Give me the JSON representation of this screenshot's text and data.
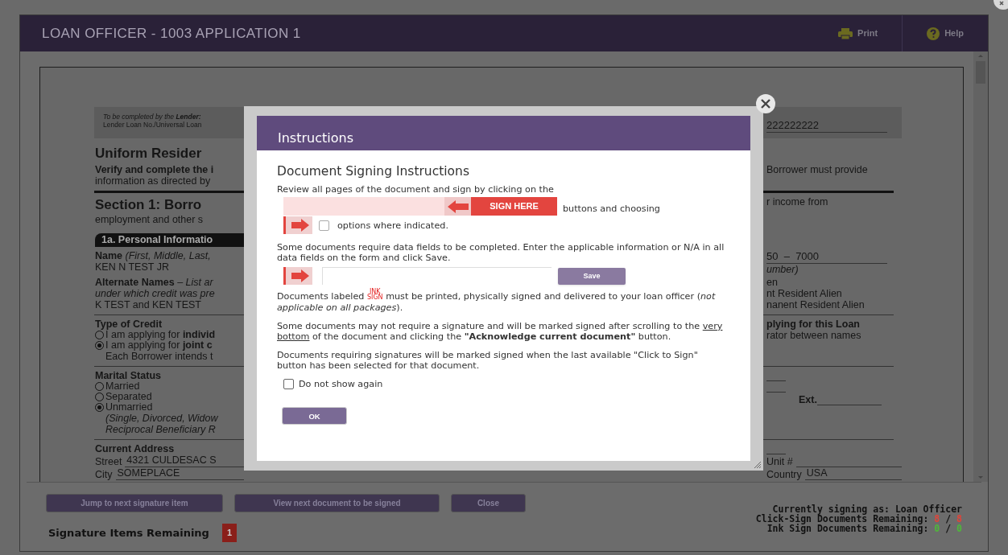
{
  "window": {
    "title": "LOAN OFFICER - 1003 APPLICATION 1",
    "actions": [
      {
        "kind": "print",
        "label": "Print"
      },
      {
        "kind": "help",
        "label": "Help"
      }
    ]
  },
  "document": {
    "rows": [
      {
        "kind": "box",
        "left": [
          {
            "kind": "italic",
            "text": "To be completed by the **Lender:**"
          },
          {
            "kind": "small",
            "text": "Lender Loan No./Universal Loan"
          }
        ],
        "right": [
          {
            "kind": "value",
            "text": "222222222"
          }
        ]
      },
      {
        "kind": "row",
        "left": [
          {
            "kind": "big",
            "text": "Uniform Resider"
          }
        ],
        "right": []
      },
      {
        "kind": "row",
        "left": [
          {
            "kind": "bold",
            "text": "Verify and complete the i"
          },
          {
            "kind": "plain",
            "text": "information as directed by"
          }
        ],
        "right": [
          {
            "kind": "plain",
            "text": "Borrower must provide"
          }
        ],
        "rule": true,
        "thick": true
      },
      {
        "kind": "row",
        "left": [
          {
            "kind": "big",
            "text": "Section 1: Borro"
          },
          {
            "kind": "plain",
            "text": "employment and other s"
          }
        ],
        "right": [
          {
            "kind": "plain",
            "text": "r income from"
          }
        ]
      },
      {
        "kind": "row",
        "left": [
          {
            "kind": "pill",
            "text": "1a. Personal Informatio"
          }
        ],
        "right": []
      },
      {
        "kind": "row",
        "left": [
          {
            "kind": "plain",
            "text": "**Name** *(First, Middle, Last,*"
          },
          {
            "kind": "plain",
            "text": "KEN N TEST JR"
          }
        ],
        "right": [
          {
            "kind": "value",
            "text": "50  –  7000"
          },
          {
            "kind": "italic",
            "text": "umber)"
          }
        ]
      },
      {
        "kind": "row",
        "left": [
          {
            "kind": "plain",
            "text": "**Alternate Names** – *List ar*"
          },
          {
            "kind": "italic",
            "text": "under which credit was pre"
          },
          {
            "kind": "plain",
            "text": "K  TEST and KEN  TEST"
          }
        ],
        "right": [
          {
            "kind": "plain",
            "text": "en"
          },
          {
            "kind": "plain",
            "text": "nt Resident Alien"
          },
          {
            "kind": "plain",
            "text": "nanent Resident Alien"
          }
        ],
        "rule": true
      },
      {
        "kind": "row",
        "left": [
          {
            "kind": "bold",
            "text": "Type of Credit"
          },
          {
            "kind": "radio",
            "text": "I am applying for **individ**",
            "selected": false
          },
          {
            "kind": "radio",
            "text": "I am applying for **joint c**",
            "selected": true
          },
          {
            "kind": "indent",
            "text": "Each Borrower intends t"
          }
        ],
        "right": [
          {
            "kind": "bold",
            "text": "plying for this Loan"
          },
          {
            "kind": "plain",
            "text": "rator between names"
          }
        ],
        "rule": true
      },
      {
        "kind": "row",
        "left": [
          {
            "kind": "bold",
            "text": "Marital Status"
          },
          {
            "kind": "radio",
            "text": "Married",
            "selected": false
          },
          {
            "kind": "radio",
            "text": "Separated",
            "selected": false
          },
          {
            "kind": "radio",
            "text": "Unmarried",
            "selected": true
          },
          {
            "kind": "indent_italic",
            "text": "(Single, Divorced, Widow"
          },
          {
            "kind": "indent_italic",
            "text": "Reciprocal Beneficiary R"
          }
        ],
        "right": [
          {
            "kind": "spacer"
          },
          {
            "kind": "spacer"
          },
          {
            "kind": "ext",
            "text": "Ext."
          }
        ],
        "rule": true
      },
      {
        "kind": "row",
        "left": [
          {
            "kind": "bold",
            "text": "Current Address"
          },
          {
            "kind": "field",
            "label": "Street",
            "text": "4321 CULDESAC S"
          },
          {
            "kind": "field",
            "label": "City",
            "text": "SOMEPLACE"
          }
        ],
        "right": [
          {
            "kind": "spacer"
          },
          {
            "kind": "field",
            "label": "Unit #"
          },
          {
            "kind": "field",
            "label": "Country",
            "text": "USA"
          }
        ]
      }
    ]
  },
  "modal": {
    "title": "Instructions",
    "heading": "Document Signing Instructions",
    "intro": "Review all pages of the document and sign by clicking on the",
    "sign_here": "SIGN HERE",
    "after_sign": "buttons and choosing",
    "options": "options where indicated.",
    "options_checked": false,
    "fields_text": "Some documents require data fields to be completed. Enter the applicable information or N/A in all data fields on the form and click Save.",
    "save": "Save",
    "ink_before": "Documents labeled",
    "ink_label": [
      "INK",
      "SIGN"
    ],
    "ink_after": "must be printed, physically signed and delivered to your loan officer (*not applicable on all packages*).",
    "ack_before": "Some documents may not require a signature and will be marked signed after scrolling to the",
    "ack_underlined": "very bottom",
    "ack_after": "of the document and clicking the **\"Acknowledge current document\"** button.",
    "final_text": "Documents requiring signatures will be marked signed when the last available \"Click to Sign\" button has been selected for that document.",
    "dont_show": {
      "label": "Do not show again",
      "checked": false
    },
    "ok": "OK"
  },
  "footer": {
    "buttons": [
      "Jump to next signature item",
      "View next document to be signed",
      "Close"
    ],
    "remaining_label": "Signature Items Remaining",
    "remaining_count": "1",
    "signing_as": "Currently signing as: Loan Officer",
    "counts": [
      {
        "label": "Click-Sign Documents Remaining:",
        "done": "8",
        "separator": "/",
        "total": "8",
        "color": "#e0453a"
      },
      {
        "label": "Ink Sign Documents Remaining:",
        "done": "0",
        "separator": "/",
        "total": "0",
        "color": "#4fb83a"
      }
    ]
  }
}
